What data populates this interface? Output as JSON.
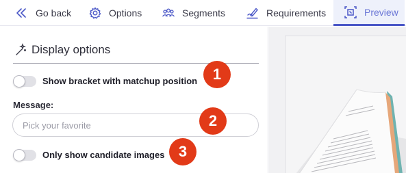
{
  "nav": {
    "items": [
      {
        "label": "Go back",
        "icon": "double-chevron-left-icon"
      },
      {
        "label": "Options",
        "icon": "gear-icon"
      },
      {
        "label": "Segments",
        "icon": "people-group-icon"
      },
      {
        "label": "Requirements",
        "icon": "pen-signature-icon"
      },
      {
        "label": "Preview",
        "icon": "frame-preview-icon"
      }
    ],
    "active": "Preview",
    "accent_color": "#4a57c7"
  },
  "display_options": {
    "title": "Display options",
    "icon": "magic-wand-icon",
    "bracket_toggle": {
      "label": "Show bracket with matchup position",
      "checked": false
    },
    "message": {
      "label": "Message:",
      "value": "",
      "placeholder": "Pick your favorite"
    },
    "candidate_toggle": {
      "label": "Only show candidate images",
      "checked": false
    }
  },
  "badges": [
    "1",
    "2",
    "3"
  ],
  "badge_color": "#e23a18",
  "preview": {
    "image": "open-book-photo"
  }
}
